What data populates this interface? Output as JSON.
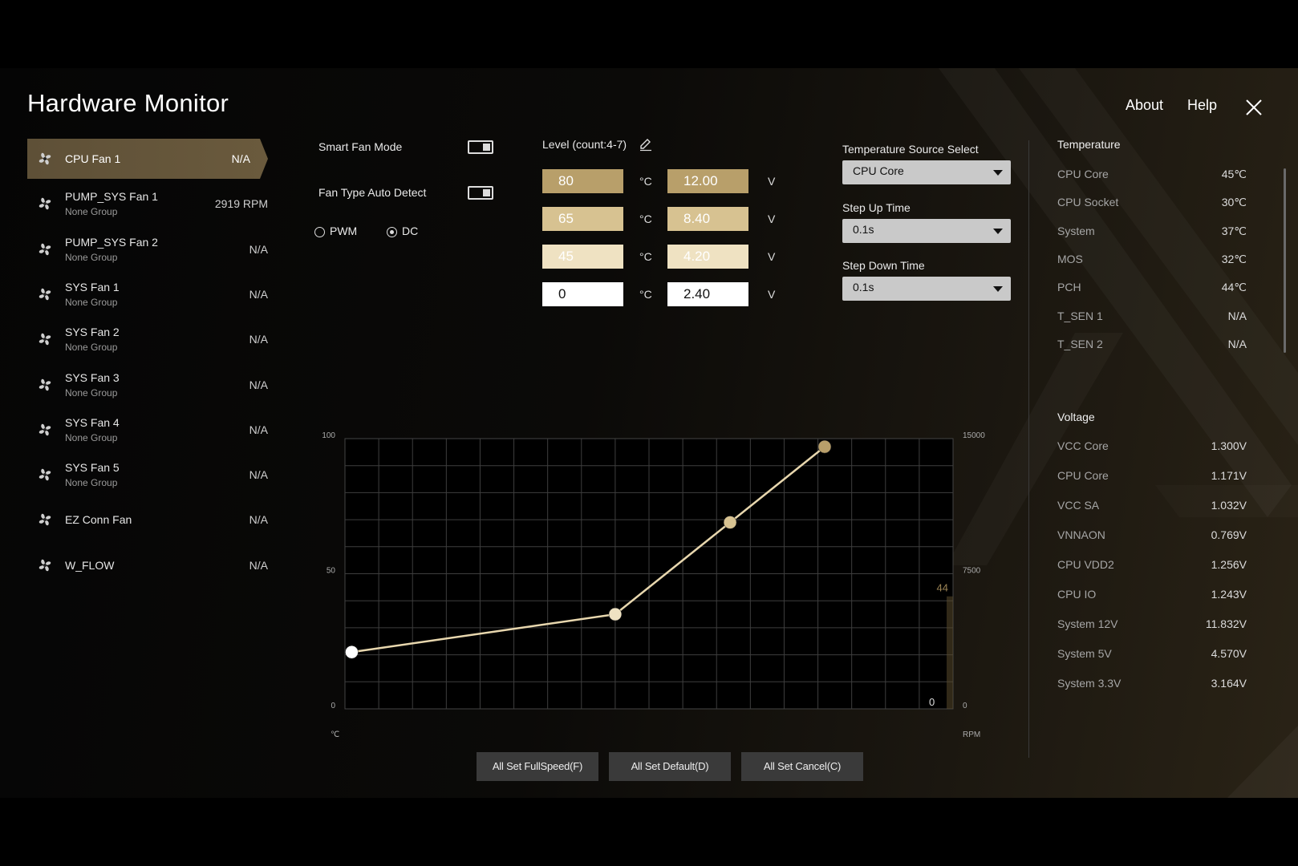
{
  "app": {
    "title": "Hardware Monitor",
    "about": "About",
    "help": "Help"
  },
  "fans": [
    {
      "name": "CPU Fan 1",
      "group": "",
      "value": "N/A",
      "active": true
    },
    {
      "name": "PUMP_SYS Fan 1",
      "group": "None Group",
      "value": "2919 RPM"
    },
    {
      "name": "PUMP_SYS Fan 2",
      "group": "None Group",
      "value": "N/A"
    },
    {
      "name": "SYS Fan 1",
      "group": "None Group",
      "value": "N/A"
    },
    {
      "name": "SYS Fan 2",
      "group": "None Group",
      "value": "N/A"
    },
    {
      "name": "SYS Fan 3",
      "group": "None Group",
      "value": "N/A"
    },
    {
      "name": "SYS Fan 4",
      "group": "None Group",
      "value": "N/A"
    },
    {
      "name": "SYS Fan 5",
      "group": "None Group",
      "value": "N/A"
    },
    {
      "name": "EZ Conn Fan",
      "group": "",
      "value": "N/A"
    },
    {
      "name": "W_FLOW",
      "group": "",
      "value": "N/A"
    }
  ],
  "settings": {
    "smart_fan_mode": "Smart Fan Mode",
    "fan_type_auto_detect": "Fan Type Auto Detect",
    "pwm": "PWM",
    "dc": "DC",
    "selected_type": "DC",
    "level_label": "Level (count:4-7)",
    "temp_unit": "°C",
    "volt_unit": "V"
  },
  "levels": [
    {
      "temp": "80",
      "volt": "12.00",
      "color": "#b89f6a"
    },
    {
      "temp": "65",
      "volt": "8.40",
      "color": "#d7c291"
    },
    {
      "temp": "45",
      "volt": "4.20",
      "color": "#efe2c2"
    },
    {
      "temp": "0",
      "volt": "2.40",
      "color": "#ffffff"
    }
  ],
  "temp_source": {
    "label": "Temperature Source Select",
    "value": "CPU Core"
  },
  "step_up": {
    "label": "Step Up Time",
    "value": "0.1s"
  },
  "step_down": {
    "label": "Step Down Time",
    "value": "0.1s"
  },
  "temperature": {
    "title": "Temperature",
    "rows": [
      {
        "name": "CPU Core",
        "value": "45℃"
      },
      {
        "name": "CPU Socket",
        "value": "30℃"
      },
      {
        "name": "System",
        "value": "37℃"
      },
      {
        "name": "MOS",
        "value": "32℃"
      },
      {
        "name": "PCH",
        "value": "44℃"
      },
      {
        "name": "T_SEN 1",
        "value": "N/A"
      },
      {
        "name": "T_SEN 2",
        "value": "N/A"
      }
    ]
  },
  "voltage": {
    "title": "Voltage",
    "rows": [
      {
        "name": "VCC Core",
        "value": "1.300V"
      },
      {
        "name": "CPU Core",
        "value": "1.171V"
      },
      {
        "name": "VCC SA",
        "value": "1.032V"
      },
      {
        "name": "VNNAON",
        "value": "0.769V"
      },
      {
        "name": "CPU VDD2",
        "value": "1.256V"
      },
      {
        "name": "CPU IO",
        "value": "1.243V"
      },
      {
        "name": "System 12V",
        "value": "11.832V"
      },
      {
        "name": "System 5V",
        "value": "4.570V"
      },
      {
        "name": "System 3.3V",
        "value": "3.164V"
      }
    ]
  },
  "chart_data": {
    "type": "line",
    "x": [
      1,
      40,
      57,
      71
    ],
    "values": [
      21,
      35,
      69,
      97
    ],
    "xlim": [
      0,
      90
    ],
    "ylim": [
      0,
      100
    ],
    "y_ticks": [
      "0",
      "50",
      "100"
    ],
    "y2_ticks": [
      "0",
      "7500",
      "15000"
    ],
    "x_unit": "℃",
    "y2_unit": "RPM",
    "current_temp": "44",
    "current_temp_value": 44,
    "current_rpm": "0",
    "point_colors": [
      "#ffffff",
      "#efe2c2",
      "#d7c291",
      "#b89f6a"
    ],
    "grid": true
  },
  "buttons": {
    "full_speed": "All Set FullSpeed(F)",
    "default": "All Set Default(D)",
    "cancel": "All Set Cancel(C)"
  },
  "colors": {
    "accent": "#c9b485",
    "line": "#e8d7ae",
    "active_fan": "#65563a"
  }
}
